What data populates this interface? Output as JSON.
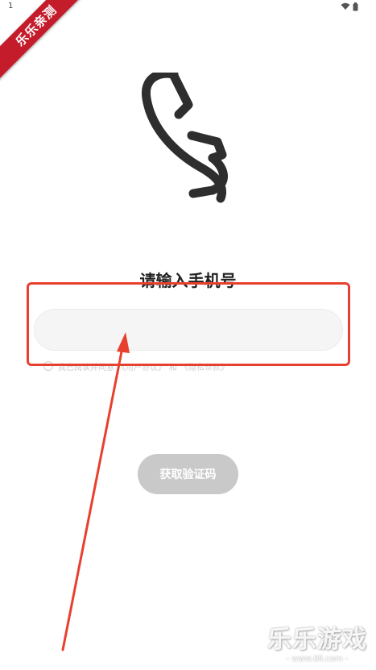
{
  "status_bar": {
    "time": "1",
    "wifi_icon": "wifi-icon",
    "battery_icon": "battery-icon"
  },
  "badge": {
    "text": "乐乐亲测"
  },
  "hero": {
    "icon": "phone-handset-icon"
  },
  "login": {
    "title": "请输入手机号",
    "phone_input": {
      "value": "",
      "placeholder": ""
    },
    "agreement": {
      "prefix": "我已阅读并同意",
      "user_agreement": "《用户协议》",
      "and": "和",
      "privacy_policy": "《隐私条款》"
    },
    "get_code_button": "获取验证码"
  },
  "annotation": {
    "color": "#e8402f"
  },
  "watermark": {
    "title": "乐乐游戏",
    "url": "- www.6ll.com -"
  },
  "colors": {
    "button_disabled": "#c9c9c9",
    "input_bg": "#f5f5f5",
    "badge_red": "#c41c2b"
  }
}
